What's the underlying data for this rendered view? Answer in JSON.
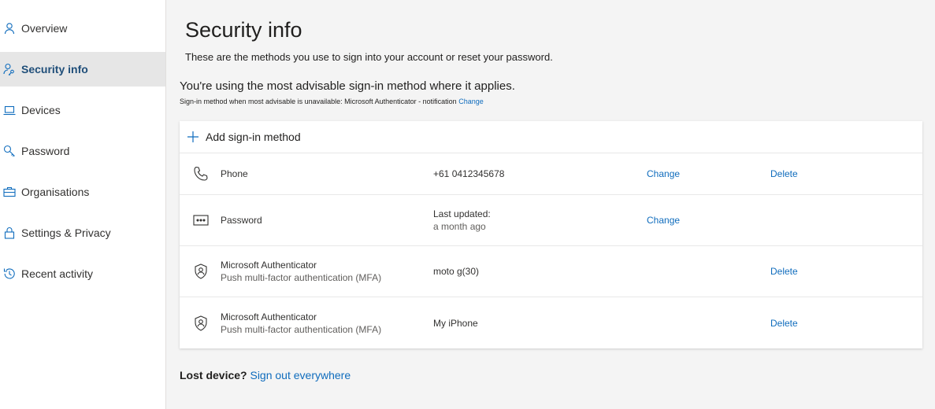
{
  "sidebar": {
    "items": [
      {
        "label": "Overview",
        "icon": "person-icon",
        "active": false
      },
      {
        "label": "Security info",
        "icon": "person-key-icon",
        "active": true
      },
      {
        "label": "Devices",
        "icon": "laptop-icon",
        "active": false
      },
      {
        "label": "Password",
        "icon": "key-icon",
        "active": false
      },
      {
        "label": "Organisations",
        "icon": "briefcase-icon",
        "active": false
      },
      {
        "label": "Settings & Privacy",
        "icon": "lock-icon",
        "active": false
      },
      {
        "label": "Recent activity",
        "icon": "history-icon",
        "active": false
      }
    ]
  },
  "main": {
    "title": "Security info",
    "subtitle": "These are the methods you use to sign into your account or reset your password.",
    "advisable": "You're using the most advisable sign-in method where it applies.",
    "advisable_sub": "Sign-in method when most advisable is unavailable: Microsoft Authenticator - notification",
    "advisable_change": "Change",
    "add_method": "Add sign-in method",
    "methods": [
      {
        "icon": "phone-icon",
        "name": "Phone",
        "detail": "+61 0412345678",
        "change": "Change",
        "delete": "Delete"
      },
      {
        "icon": "password-icon",
        "name": "Password",
        "detail": "Last updated:",
        "detail_sub": "a month ago",
        "change": "Change"
      },
      {
        "icon": "authenticator-icon",
        "name": "Microsoft Authenticator",
        "name_sub": "Push multi-factor authentication (MFA)",
        "detail": "moto g(30)",
        "delete": "Delete"
      },
      {
        "icon": "authenticator-icon",
        "name": "Microsoft Authenticator",
        "name_sub": "Push multi-factor authentication (MFA)",
        "detail": "My iPhone",
        "delete": "Delete"
      }
    ],
    "lost_device": "Lost device?",
    "sign_out": "Sign out everywhere"
  },
  "colors": {
    "accent": "#0f6cbd",
    "active_nav_text": "#1f4e79",
    "active_nav_bg": "#e6e6e6",
    "page_bg": "#f4f4f4"
  }
}
